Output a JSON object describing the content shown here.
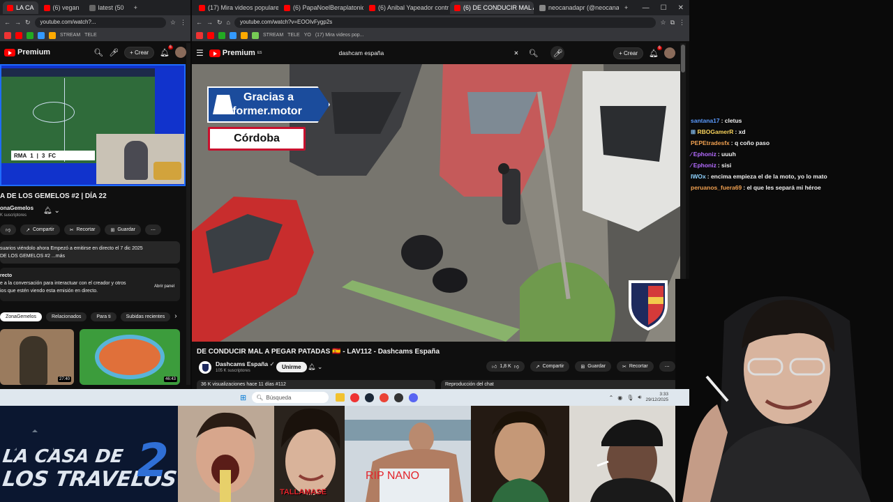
{
  "left_browser": {
    "tabs": [
      {
        "label": "LA CA"
      },
      {
        "label": "(6) vegan"
      },
      {
        "label": "latest (50"
      },
      {
        "label": "+"
      }
    ],
    "url": "youtube.com/watch?...",
    "bookmarks": [
      "STREAM",
      "TELE"
    ],
    "youtube": {
      "brand": "Premium",
      "create_label": "Crear",
      "notif_count": "6",
      "scoreboard": {
        "home": "RMA",
        "home_score": "1",
        "away_score": "3",
        "away": "FC"
      },
      "video_title": "A DE LOS GEMELOS #2 | DÍA 22",
      "channel_name": "onaGemelos",
      "subscribers": "K suscriptores",
      "actions": {
        "share": "Compartir",
        "clip": "Recortar",
        "save": "Guardar"
      },
      "description_line1": "suarios viéndolo ahora  Empezó a emitirse en directo el 7 dic 2025",
      "description_line2": "DE LOS GEMELOS #2 ...más",
      "chat_title": "recto",
      "chat_info_line1": "e a la conversación para interactuar con el creador y otros",
      "chat_info_line2": "ios que estén viendo esta emisión en directo.",
      "open_panel": "Abrir panel",
      "chips": [
        "ZonaGemelos",
        "Relacionados",
        "Para ti",
        "Subidas recientes"
      ],
      "thumb1_duration": "27:40",
      "thumb2_duration": "46:43"
    }
  },
  "right_browser": {
    "tabs": [
      {
        "label": "(17) Mira videos populares en"
      },
      {
        "label": "(6) PapaNoelBeraplatonico -"
      },
      {
        "label": "(6) Anibal Yapeador contrario"
      },
      {
        "label": "(6) DE CONDUCIR MAL A PEGAR"
      },
      {
        "label": "neocanadapr (@neocanadap"
      },
      {
        "label": "+"
      }
    ],
    "url": "youtube.com/watch?v=EOOIvFygp2s",
    "bookmarks": [
      "STREAM",
      "TELE",
      "YO",
      "(17) Mira videos pop..."
    ],
    "youtube": {
      "brand": "Premium",
      "brand_super": "ES",
      "search_value": "dashcam españa",
      "create_label": "Crear",
      "notif_count": "6",
      "overlay_thanks_line1": "Gracias a",
      "overlay_thanks_line2": "Informer.motor",
      "overlay_city": "Córdoba",
      "video_title": "DE CONDUCIR MAL A PEGAR PATADAS 🇪🇸 - LAV112 - Dashcams España",
      "channel_name": "Dashcams España",
      "subscribers": "105 K suscriptores",
      "join_label": "Unirme",
      "likes": "1,8 K",
      "share_label": "Compartir",
      "save_label": "Guardar",
      "clip_label": "Recortar",
      "views": "36 K visualizaciones  hace 11 días  #112",
      "chat_replay": "Reproducción del chat"
    }
  },
  "chat": [
    {
      "user": "santana17",
      "color": "#5b9bff",
      "msg": "cletus",
      "badge": false
    },
    {
      "user": "RBOGamerR",
      "color": "#f7d25b",
      "msg": "xd",
      "badge": true
    },
    {
      "user": "PEPEtradesfx",
      "color": "#f0a050",
      "msg": "q coño paso",
      "badge": false
    },
    {
      "user": "Ephoniz",
      "color": "#b46bff",
      "msg": "uuuh",
      "badge": true
    },
    {
      "user": "Ephoniz",
      "color": "#b46bff",
      "msg": "sisi",
      "badge": true
    },
    {
      "user": "IWOx",
      "color": "#8fd3ff",
      "msg": "encima empieza el de la moto, yo lo mato",
      "badge": false
    },
    {
      "user": "peruanos_fuera69",
      "color": "#f0a050",
      "msg": "el que les separá mi héroe",
      "badge": false
    }
  ],
  "taskbar": {
    "search_placeholder": "Búsqueda",
    "time": "3:33",
    "date": "29/12/2025"
  },
  "bottom_strip": {
    "logo_line1": "LA CASA DE",
    "logo_line2": "LOS TRAVELOS",
    "logo_number": "2",
    "cam2_caption": "TALLAMASE",
    "cam4_caption": "RIP NANO"
  }
}
